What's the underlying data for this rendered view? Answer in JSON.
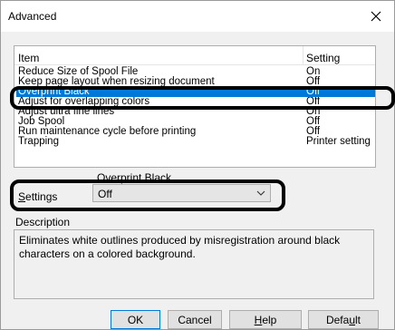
{
  "window": {
    "title": "Advanced"
  },
  "list": {
    "headers": {
      "item": "Item",
      "setting": "Setting"
    },
    "rows": [
      {
        "item": "Reduce Size of Spool File",
        "setting": "On"
      },
      {
        "item": "Keep page layout when resizing document",
        "setting": "Off"
      },
      {
        "item": "Overprint Black",
        "setting": "Off"
      },
      {
        "item": "Adjust for overlapping colors",
        "setting": "Off"
      },
      {
        "item": "Adjust ultra fine lines",
        "setting": "On"
      },
      {
        "item": "Job Spool",
        "setting": "Off"
      },
      {
        "item": "Run maintenance cycle before printing",
        "setting": "Off"
      },
      {
        "item": "Trapping",
        "setting": "Printer setting"
      }
    ]
  },
  "group": {
    "title": "Overprint Black"
  },
  "settings": {
    "label_accel": "S",
    "label_rest": "ettings",
    "value": "Off"
  },
  "description": {
    "label": "Description",
    "text": "Eliminates white outlines produced by misregistration around black characters on a colored background."
  },
  "buttons": {
    "ok": "OK",
    "cancel": "Cancel",
    "help_accel": "H",
    "help_rest": "elp",
    "default_pre": "Defa",
    "default_accel": "u",
    "default_post": "lt"
  }
}
